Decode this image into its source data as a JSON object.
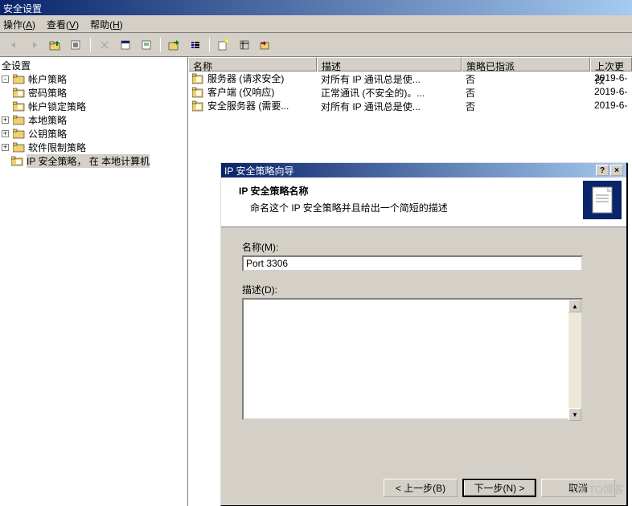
{
  "window": {
    "title": "安全设置"
  },
  "menu": {
    "action": "操作",
    "action_hk": "A",
    "view": "查看",
    "view_hk": "V",
    "help": "帮助",
    "help_hk": "H"
  },
  "tree": {
    "root": "全设置",
    "account": "帐户策略",
    "password": "密码策略",
    "lockout": "帐户锁定策略",
    "local": "本地策略",
    "pubkey": "公钥策略",
    "software": "软件限制策略",
    "ipsec": "IP 安全策略， 在 本地计算机"
  },
  "list": {
    "headers": {
      "name": "名称",
      "desc": "描述",
      "assigned": "策略已指派",
      "date": "上次更改"
    },
    "rows": [
      {
        "name": "服务器 (请求安全)",
        "desc": "对所有 IP 通讯总是使...",
        "assigned": "否",
        "date": "2019-6-"
      },
      {
        "name": "客户端 (仅响应)",
        "desc": "正常通讯 (不安全的)。...",
        "assigned": "否",
        "date": "2019-6-"
      },
      {
        "name": "安全服务器 (需要...",
        "desc": "对所有 IP 通讯总是使...",
        "assigned": "否",
        "date": "2019-6-"
      }
    ]
  },
  "dialog": {
    "title": "IP 安全策略向导",
    "help_btn": "?",
    "close_btn": "×",
    "header": {
      "title": "IP 安全策略名称",
      "subtitle": "命名这个 IP 安全策略并且给出一个简短的描述"
    },
    "name_label": "名称(M):",
    "name_value": "Port 3306",
    "desc_label": "描述(D):",
    "desc_value": "",
    "buttons": {
      "back": "< 上一步(B)",
      "next": "下一步(N) >",
      "cancel": "取消"
    }
  },
  "watermark": "51CTO博客"
}
